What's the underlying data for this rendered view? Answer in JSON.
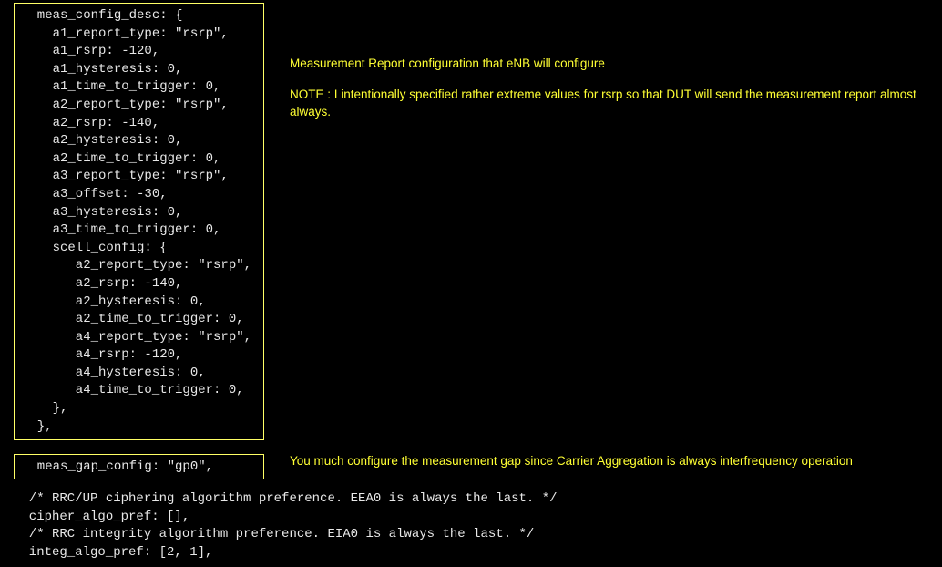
{
  "block1_code": "  meas_config_desc: {\n    a1_report_type: \"rsrp\",\n    a1_rsrp: -120,\n    a1_hysteresis: 0,\n    a1_time_to_trigger: 0,\n    a2_report_type: \"rsrp\",\n    a2_rsrp: -140,\n    a2_hysteresis: 0,\n    a2_time_to_trigger: 0,\n    a3_report_type: \"rsrp\",\n    a3_offset: -30,\n    a3_hysteresis: 0,\n    a3_time_to_trigger: 0,\n    scell_config: {\n       a2_report_type: \"rsrp\",\n       a2_rsrp: -140,\n       a2_hysteresis: 0,\n       a2_time_to_trigger: 0,\n       a4_report_type: \"rsrp\",\n       a4_rsrp: -120,\n       a4_hysteresis: 0,\n       a4_time_to_trigger: 0,\n    },\n  },",
  "annot1_line1": "Measurement Report configuration that eNB will configure",
  "annot1_line2": "NOTE : I intentionally specified rather extreme values for rsrp so that DUT will send the measurement report almost always.",
  "block2_code": "  meas_gap_config: \"gp0\",",
  "annot2": "You much configure the measurement gap since Carrier Aggregation is always interfrequency operation",
  "bottom_code": "  /* RRC/UP ciphering algorithm preference. EEA0 is always the last. */\n  cipher_algo_pref: [],\n  /* RRC integrity algorithm preference. EIA0 is always the last. */\n  integ_algo_pref: [2, 1],"
}
